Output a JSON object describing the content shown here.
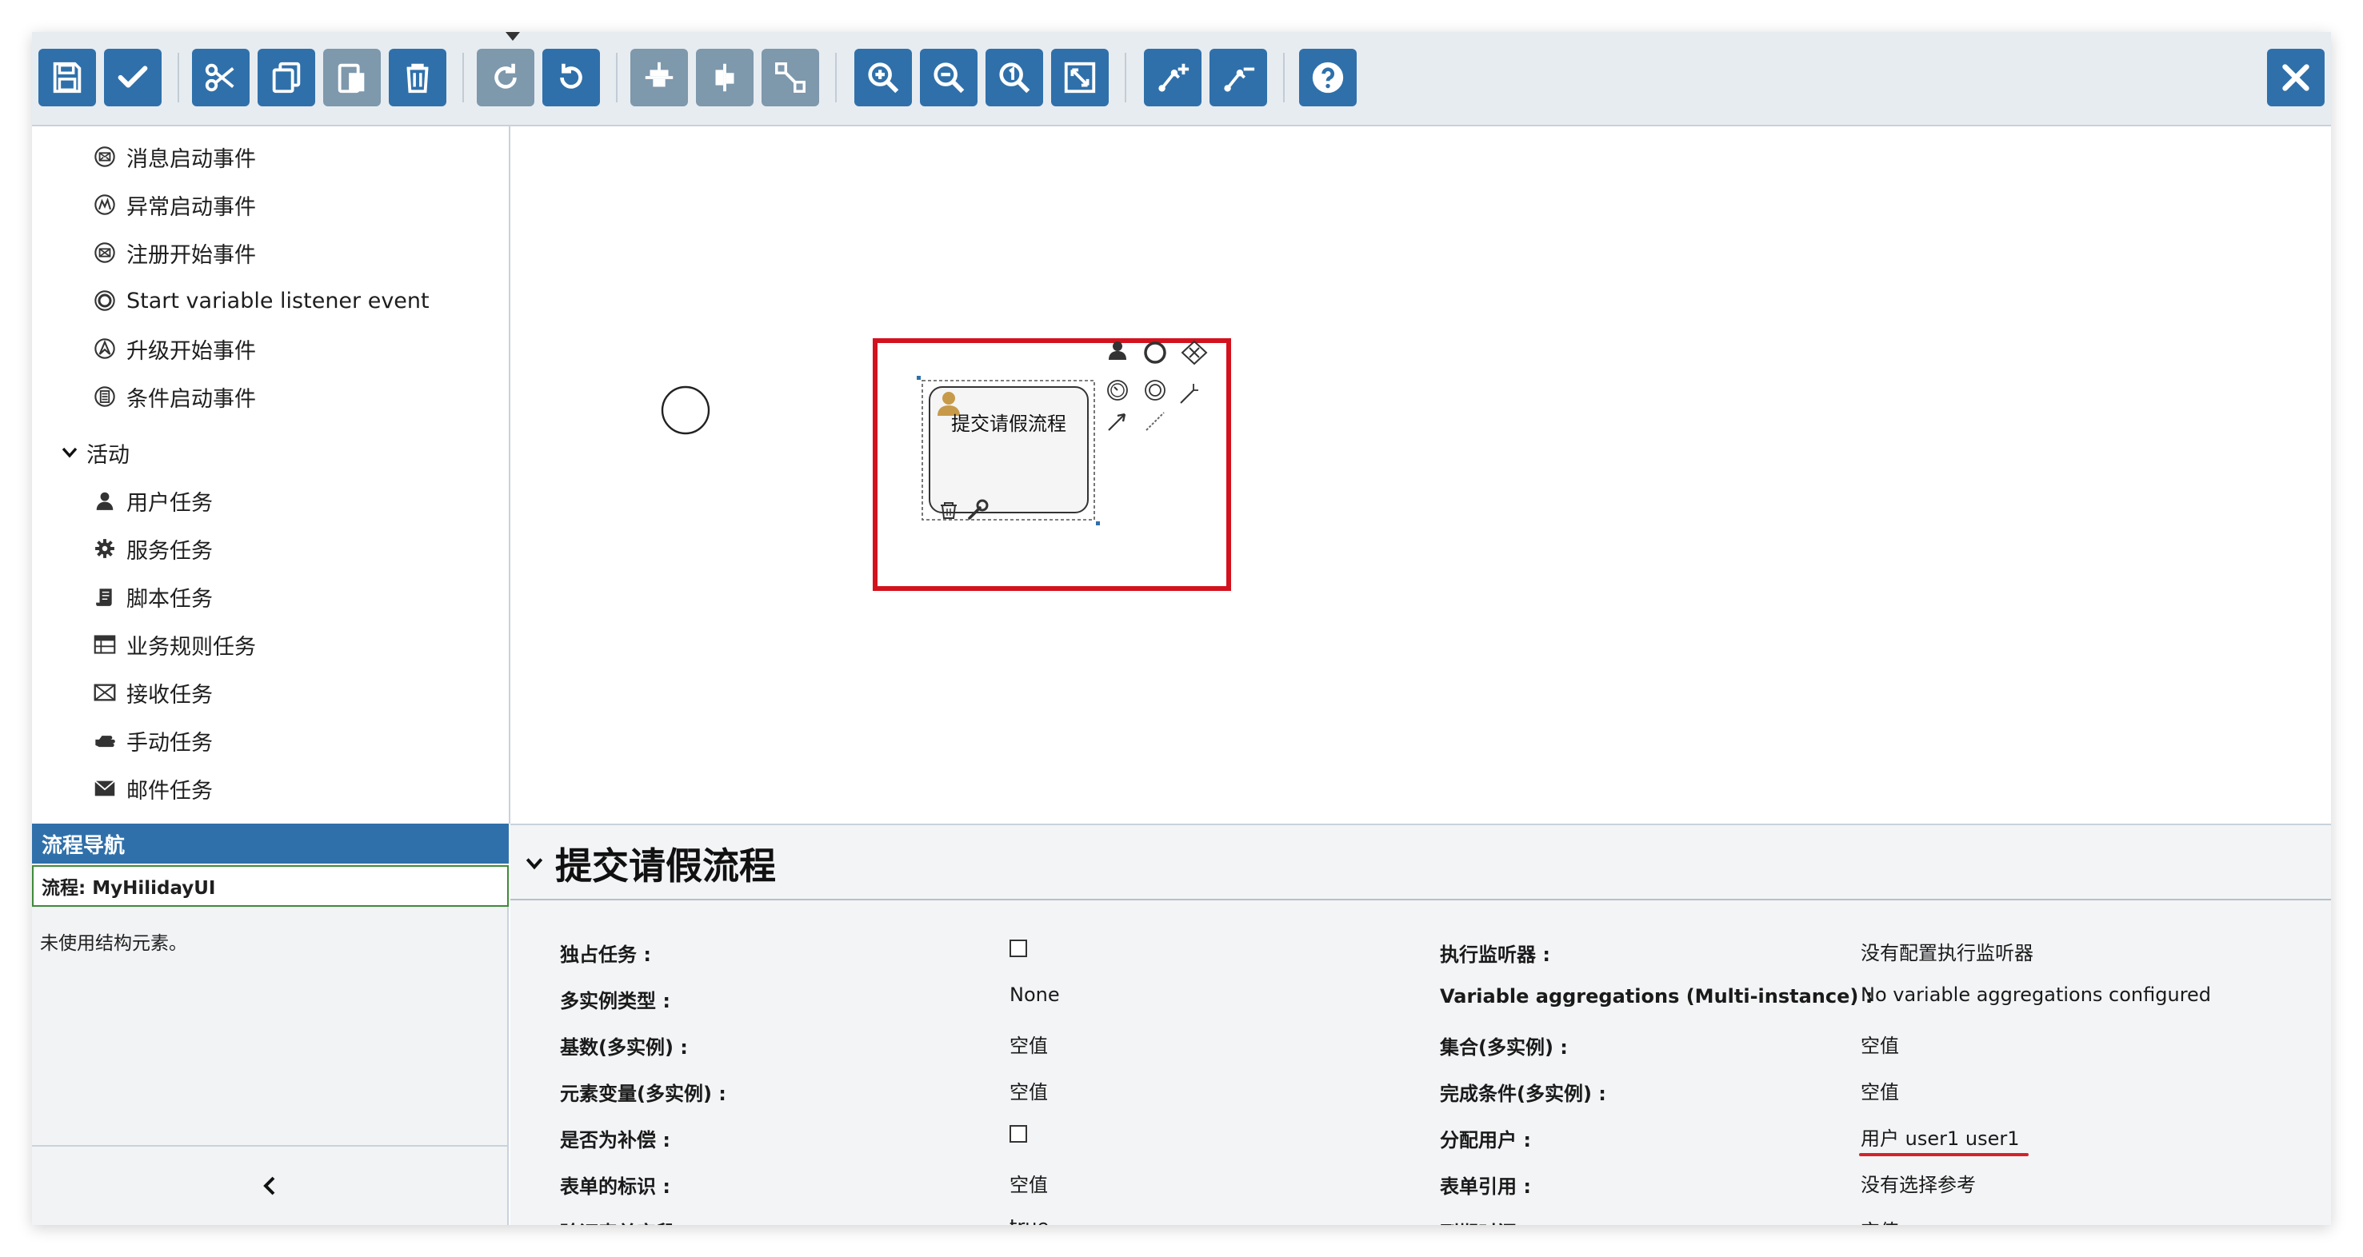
{
  "toolbar": {
    "buttons": [
      {
        "icon": "save-icon",
        "state": "enabled"
      },
      {
        "icon": "check-icon",
        "state": "enabled"
      },
      {
        "icon": "cut-icon",
        "state": "enabled"
      },
      {
        "icon": "copy-icon",
        "state": "enabled"
      },
      {
        "icon": "paste-icon",
        "state": "disabled"
      },
      {
        "icon": "delete-icon",
        "state": "enabled"
      },
      {
        "icon": "redo-icon",
        "state": "disabled"
      },
      {
        "icon": "undo-icon",
        "state": "enabled"
      },
      {
        "icon": "align-horizontal-icon",
        "state": "disabled"
      },
      {
        "icon": "align-vertical-icon",
        "state": "disabled"
      },
      {
        "icon": "same-size-icon",
        "state": "disabled"
      },
      {
        "icon": "zoom-in-icon",
        "state": "enabled"
      },
      {
        "icon": "zoom-out-icon",
        "state": "enabled"
      },
      {
        "icon": "zoom-actual-icon",
        "state": "enabled"
      },
      {
        "icon": "zoom-fit-icon",
        "state": "enabled"
      },
      {
        "icon": "add-bendpoint-icon",
        "state": "enabled"
      },
      {
        "icon": "remove-bendpoint-icon",
        "state": "enabled"
      },
      {
        "icon": "help-icon",
        "state": "enabled"
      },
      {
        "icon": "close-icon",
        "state": "enabled"
      }
    ],
    "colors": {
      "enabled": "#2f70aa",
      "disabled": "#7e98ac"
    }
  },
  "palette": {
    "start_events": [
      {
        "label": "消息启动事件",
        "icon": "message-start-icon"
      },
      {
        "label": "异常启动事件",
        "icon": "error-start-icon"
      },
      {
        "label": "注册开始事件",
        "icon": "signal-start-icon"
      },
      {
        "label": "Start variable listener event",
        "icon": "variable-listener-start-icon"
      },
      {
        "label": "升级开始事件",
        "icon": "escalation-start-icon"
      },
      {
        "label": "条件启动事件",
        "icon": "conditional-start-icon"
      }
    ],
    "activities_group": "活动",
    "activities": [
      {
        "label": "用户任务",
        "icon": "user-icon"
      },
      {
        "label": "服务任务",
        "icon": "gear-icon"
      },
      {
        "label": "脚本任务",
        "icon": "script-icon"
      },
      {
        "label": "业务规则任务",
        "icon": "table-icon"
      },
      {
        "label": "接收任务",
        "icon": "envelope-outline-icon"
      },
      {
        "label": "手动任务",
        "icon": "hand-icon"
      },
      {
        "label": "邮件任务",
        "icon": "envelope-icon"
      }
    ]
  },
  "canvas": {
    "task_label": "提交请假流程",
    "highlight_color": "#d3121e"
  },
  "navigator": {
    "title": "流程导航",
    "process": "流程: MyHilidayUI",
    "unused": "未使用结构元素。"
  },
  "properties": {
    "title": "提交请假流程",
    "left": [
      {
        "label": "独占任务 :",
        "type": "checkbox",
        "checked": false
      },
      {
        "label": "多实例类型 :",
        "type": "text",
        "value": "None"
      },
      {
        "label": "基数(多实例) :",
        "type": "text",
        "value": "空值"
      },
      {
        "label": "元素变量(多实例) :",
        "type": "text",
        "value": "空值"
      },
      {
        "label": "是否为补偿 :",
        "type": "checkbox",
        "checked": false
      },
      {
        "label": "表单的标识 :",
        "type": "text",
        "value": "空值"
      },
      {
        "label": "验证表单字段 :",
        "type": "text",
        "value": "true"
      }
    ],
    "right": [
      {
        "label": "执行监听器 :",
        "value": "没有配置执行监听器"
      },
      {
        "label": "Variable aggregations (Multi-instance) :",
        "value": "No variable aggregations configured"
      },
      {
        "label": "集合(多实例) :",
        "value": "空值"
      },
      {
        "label": "完成条件(多实例) :",
        "value": "空值"
      },
      {
        "label": "分配用户 :",
        "value": "用户 user1 user1"
      },
      {
        "label": "表单引用 :",
        "value": "没有选择参考"
      },
      {
        "label": "到期时间 :",
        "value": "空值"
      }
    ]
  }
}
